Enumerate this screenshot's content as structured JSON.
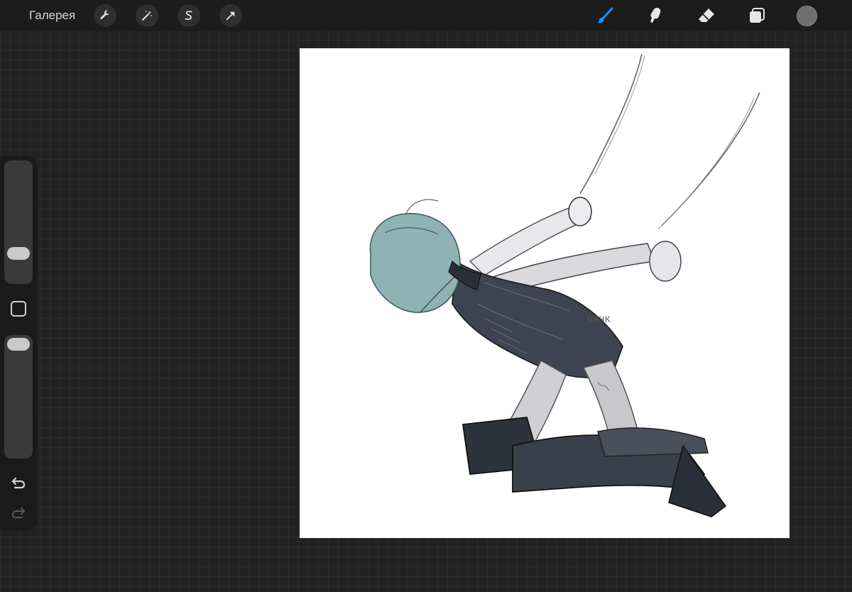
{
  "toolbar": {
    "gallery_label": "Галерея",
    "left_tools": [
      {
        "icon": "wrench-icon"
      },
      {
        "icon": "magic-wand-icon"
      },
      {
        "icon": "selection-s-icon"
      },
      {
        "icon": "transform-arrow-icon"
      }
    ],
    "right_tools": [
      {
        "icon": "brush-icon",
        "active": true,
        "color": "#1e90ff"
      },
      {
        "icon": "smudge-icon",
        "active": false
      },
      {
        "icon": "eraser-icon",
        "active": false
      },
      {
        "icon": "layers-icon",
        "active": false
      }
    ],
    "current_color": "#6f6f6f"
  },
  "sidebar": {
    "brush_size_level": 0.33,
    "opacity_level": 1.0,
    "icons": [
      "modify-square-icon",
      "undo-icon",
      "redo-icon"
    ]
  },
  "canvas": {
    "background": "#ffffff",
    "artwork_text": "ЧИНК"
  }
}
